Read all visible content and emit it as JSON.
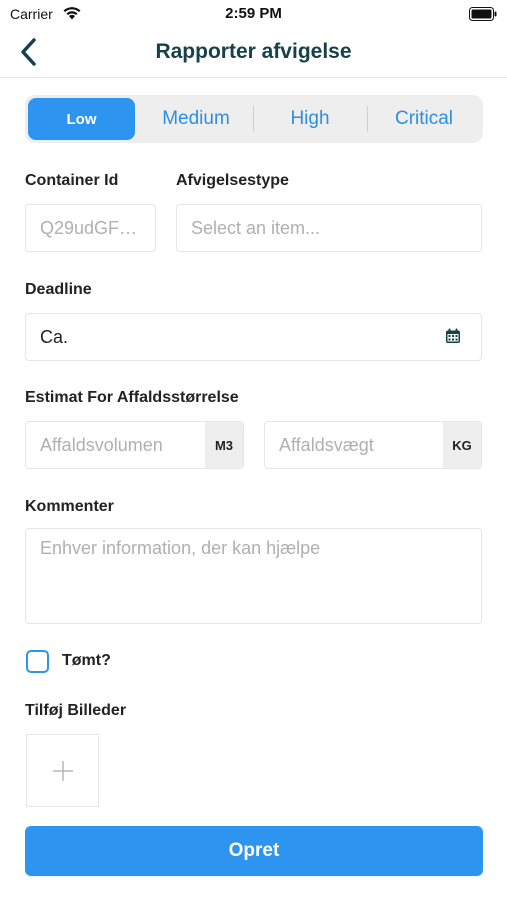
{
  "status_bar": {
    "carrier": "Carrier",
    "time": "2:59 PM"
  },
  "nav": {
    "title": "Rapporter afvigelse",
    "back_icon": "chevron-left-icon"
  },
  "priority": {
    "options": [
      "Low",
      "Medium",
      "High",
      "Critical"
    ],
    "selected": "Low"
  },
  "form": {
    "container_id": {
      "label": "Container Id",
      "placeholder": "Q29udGF…"
    },
    "deviation_type": {
      "label": "Afvigelsestype",
      "placeholder": "Select an item..."
    },
    "deadline": {
      "label": "Deadline",
      "value": "Ca.",
      "icon": "calendar-icon"
    },
    "estimate": {
      "label": "Estimat For Affaldsstørrelse",
      "volume_placeholder": "Affaldsvolumen",
      "volume_unit": "M3",
      "weight_placeholder": "Affaldsvægt",
      "weight_unit": "KG"
    },
    "comment": {
      "label": "Kommenter",
      "placeholder": "Enhver information, der kan hjælpe"
    },
    "emptied": {
      "label": "Tømt?",
      "checked": false
    },
    "photos": {
      "label": "Tilføj Billeder",
      "add_icon": "plus-icon"
    }
  },
  "submit_label": "Opret",
  "colors": {
    "accent": "#2d94f0",
    "title": "#17414a"
  }
}
